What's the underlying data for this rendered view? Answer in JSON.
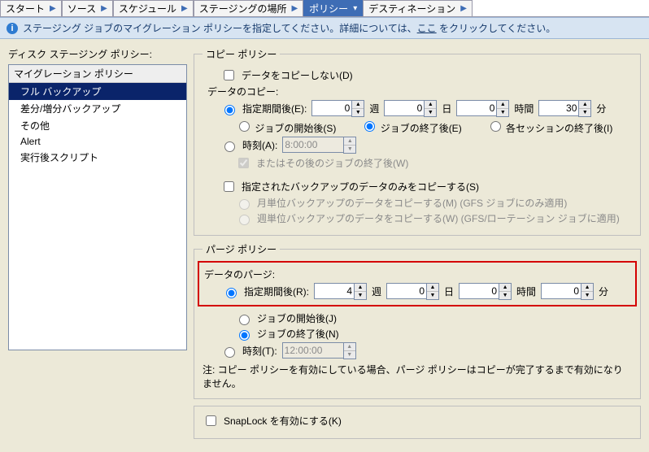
{
  "tabs": [
    "スタート",
    "ソース",
    "スケジュール",
    "ステージングの場所",
    "ポリシー",
    "デスティネーション"
  ],
  "tabs_active": 4,
  "info": {
    "pre": "ステージング ジョブのマイグレーション ポリシーを指定してください。詳細については、",
    "link": "ここ",
    "post": " をクリックしてください。"
  },
  "left": {
    "title": "ディスク ステージング ポリシー:",
    "header": "マイグレーション ポリシー",
    "items": [
      "フル バックアップ",
      "差分/増分バックアップ",
      "その他",
      "Alert",
      "実行後スクリプト"
    ],
    "selected": 0
  },
  "copy": {
    "legend": "コピー ポリシー",
    "no_copy": "データをコピーしない(D)",
    "section": "データのコピー:",
    "period": "指定期間後(E):",
    "period_w": "0",
    "period_d": "0",
    "period_h": "0",
    "period_m": "30",
    "unit_w": "週",
    "unit_d": "日",
    "unit_h": "時間",
    "unit_m": "分",
    "after_start": "ジョブの開始後(S)",
    "after_end": "ジョブの終了後(E)",
    "after_session": "各セッションの終了後(I)",
    "time": "時刻(A):",
    "time_val": "8:00:00",
    "or_after": "またはその後のジョブの終了後(W)",
    "only_backup": "指定されたバックアップのデータのみをコピーする(S)",
    "monthly": "月単位バックアップのデータをコピーする(M) (GFS ジョブにのみ適用)",
    "weekly": "週単位バックアップのデータをコピーする(W) (GFS/ローテーション ジョブに適用)"
  },
  "purge": {
    "legend": "パージ ポリシー",
    "section": "データのパージ:",
    "period": "指定期間後(R):",
    "period_w": "4",
    "period_d": "0",
    "period_h": "0",
    "period_m": "0",
    "after_start": "ジョブの開始後(J)",
    "after_end": "ジョブの終了後(N)",
    "time": "時刻(T):",
    "time_val": "12:00:00",
    "note": "注: コピー ポリシーを有効にしている場合、パージ ポリシーはコピーが完了するまで有効になりません。"
  },
  "snaplock": "SnapLock を有効にする(K)"
}
